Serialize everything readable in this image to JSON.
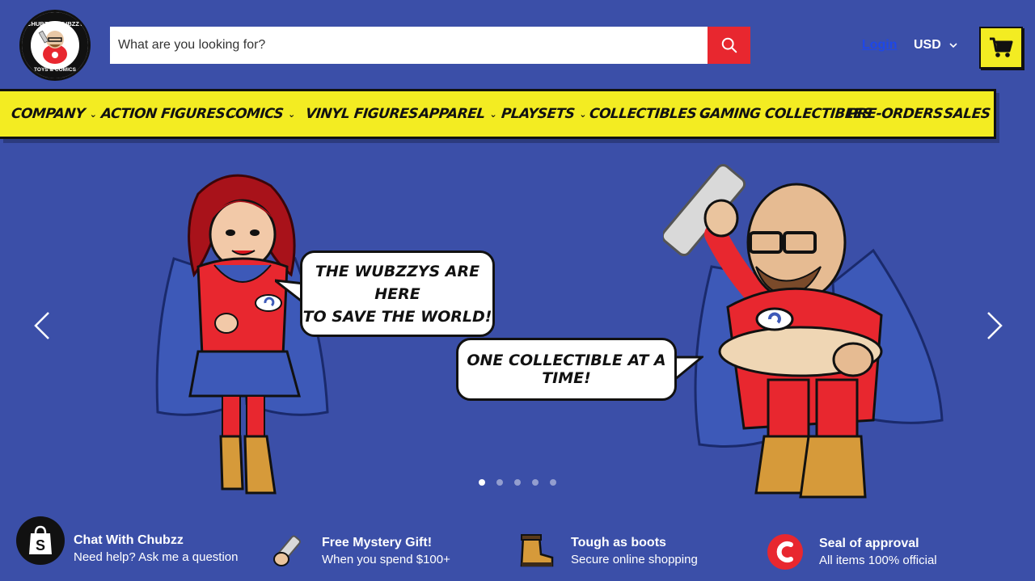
{
  "header": {
    "logo_text_top": "CHUBZZY WUBZZY",
    "logo_text_bottom": "TOYS & COMICS",
    "search_placeholder": "What are you looking for?",
    "login_label": "Login",
    "currency": "USD"
  },
  "nav": {
    "items": [
      {
        "label": "COMPANY",
        "has_dropdown": true
      },
      {
        "label": "ACTION FIGURES",
        "has_dropdown": true
      },
      {
        "label": "COMICS",
        "has_dropdown": true
      },
      {
        "label": "VINYL FIGURES",
        "has_dropdown": true
      },
      {
        "label": "APPAREL",
        "has_dropdown": true
      },
      {
        "label": "PLAYSETS",
        "has_dropdown": true
      },
      {
        "label": "COLLECTIBLES",
        "has_dropdown": true
      },
      {
        "label": "GAMING COLLECTIBLES",
        "has_dropdown": false
      },
      {
        "label": "PRE-ORDERS",
        "has_dropdown": false
      },
      {
        "label": "SALES",
        "has_dropdown": false
      }
    ]
  },
  "hero": {
    "bubble1_line1": "THE WUBZZYS ARE HERE",
    "bubble1_line2": "TO SAVE THE WORLD!",
    "bubble2": "ONE COLLECTIBLE AT A TIME!",
    "slide_count": 5,
    "active_slide": 1
  },
  "features": [
    {
      "title": "Chat With Chubzz",
      "subtitle": "Need help? Ask me a question",
      "icon": "chat-icon"
    },
    {
      "title": "Free Mystery Gift!",
      "subtitle": "When you spend $100+",
      "icon": "comic-scroll-icon"
    },
    {
      "title": "Tough as boots",
      "subtitle": "Secure online shopping",
      "icon": "boot-icon"
    },
    {
      "title": "Seal of approval",
      "subtitle": "All items 100% official",
      "icon": "seal-icon"
    }
  ],
  "colors": {
    "background": "#3b4fa8",
    "nav_yellow": "#f3ec22",
    "search_red": "#e8272f",
    "link_blue": "#1e47e8"
  }
}
